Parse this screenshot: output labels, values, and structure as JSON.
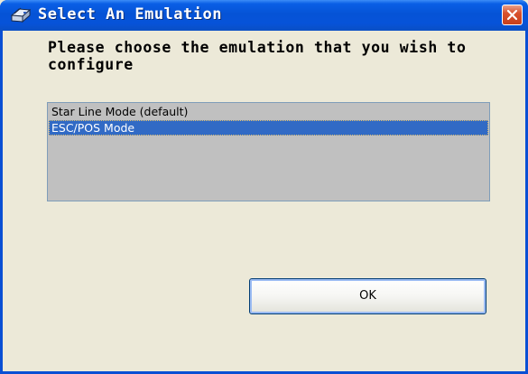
{
  "window": {
    "title": "Select An Emulation",
    "title_icon": "printer-fax-icon",
    "close_icon": "close-icon",
    "accent_color": "#0a57d6",
    "close_color": "#d9522e"
  },
  "dialog": {
    "prompt": "Please choose the emulation that you wish to configure",
    "emulations": [
      {
        "label": "Star Line Mode (default)",
        "selected": false
      },
      {
        "label": "ESC/POS Mode",
        "selected": true
      }
    ],
    "ok_label": "OK",
    "selection_color": "#316ac5"
  }
}
